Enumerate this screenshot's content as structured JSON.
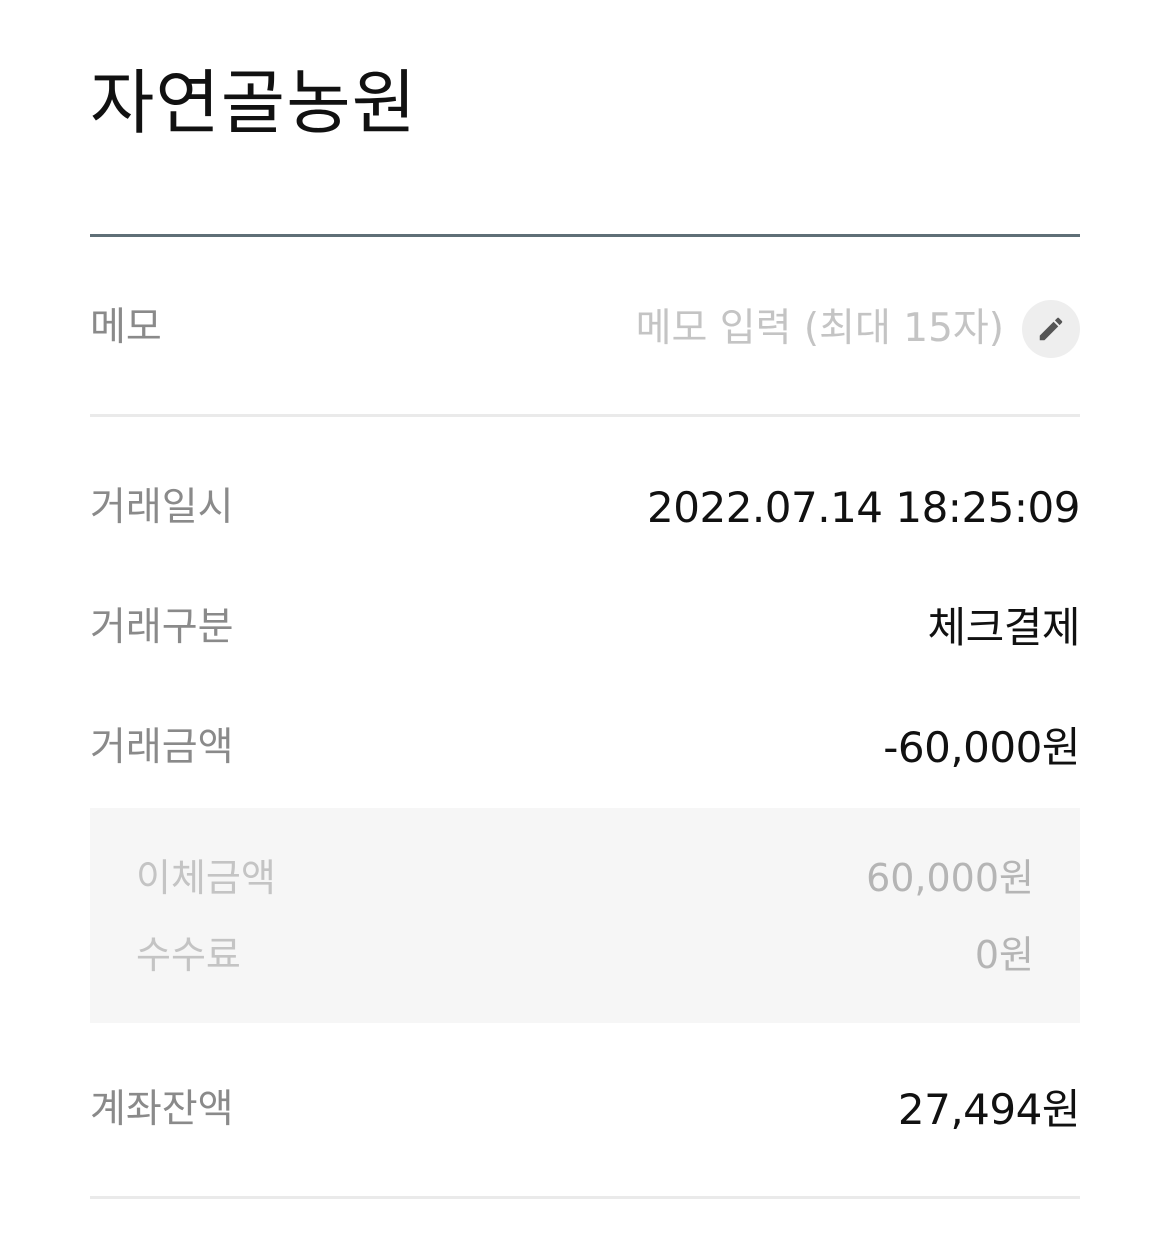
{
  "header": {
    "title": "자연골농원"
  },
  "memo": {
    "label": "메모",
    "value": "",
    "placeholder": "메모 입력 (최대 15자)",
    "edit_icon": "pencil-icon"
  },
  "transaction": {
    "datetime_label": "거래일시",
    "datetime_value": "2022.07.14 18:25:09",
    "type_label": "거래구분",
    "type_value": "체크결제",
    "amount_label": "거래금액",
    "amount_value": "-60,000원"
  },
  "details": {
    "transfer_label": "이체금액",
    "transfer_value": "60,000원",
    "fee_label": "수수료",
    "fee_value": "0원"
  },
  "balance": {
    "label": "계좌잔액",
    "value": "27,494원"
  },
  "colors": {
    "title_rule": "#5f6f77",
    "label": "#8a8a8a",
    "placeholder": "#c4c4c4",
    "detail_bg": "#f6f6f6",
    "divider": "#eaeaea"
  }
}
